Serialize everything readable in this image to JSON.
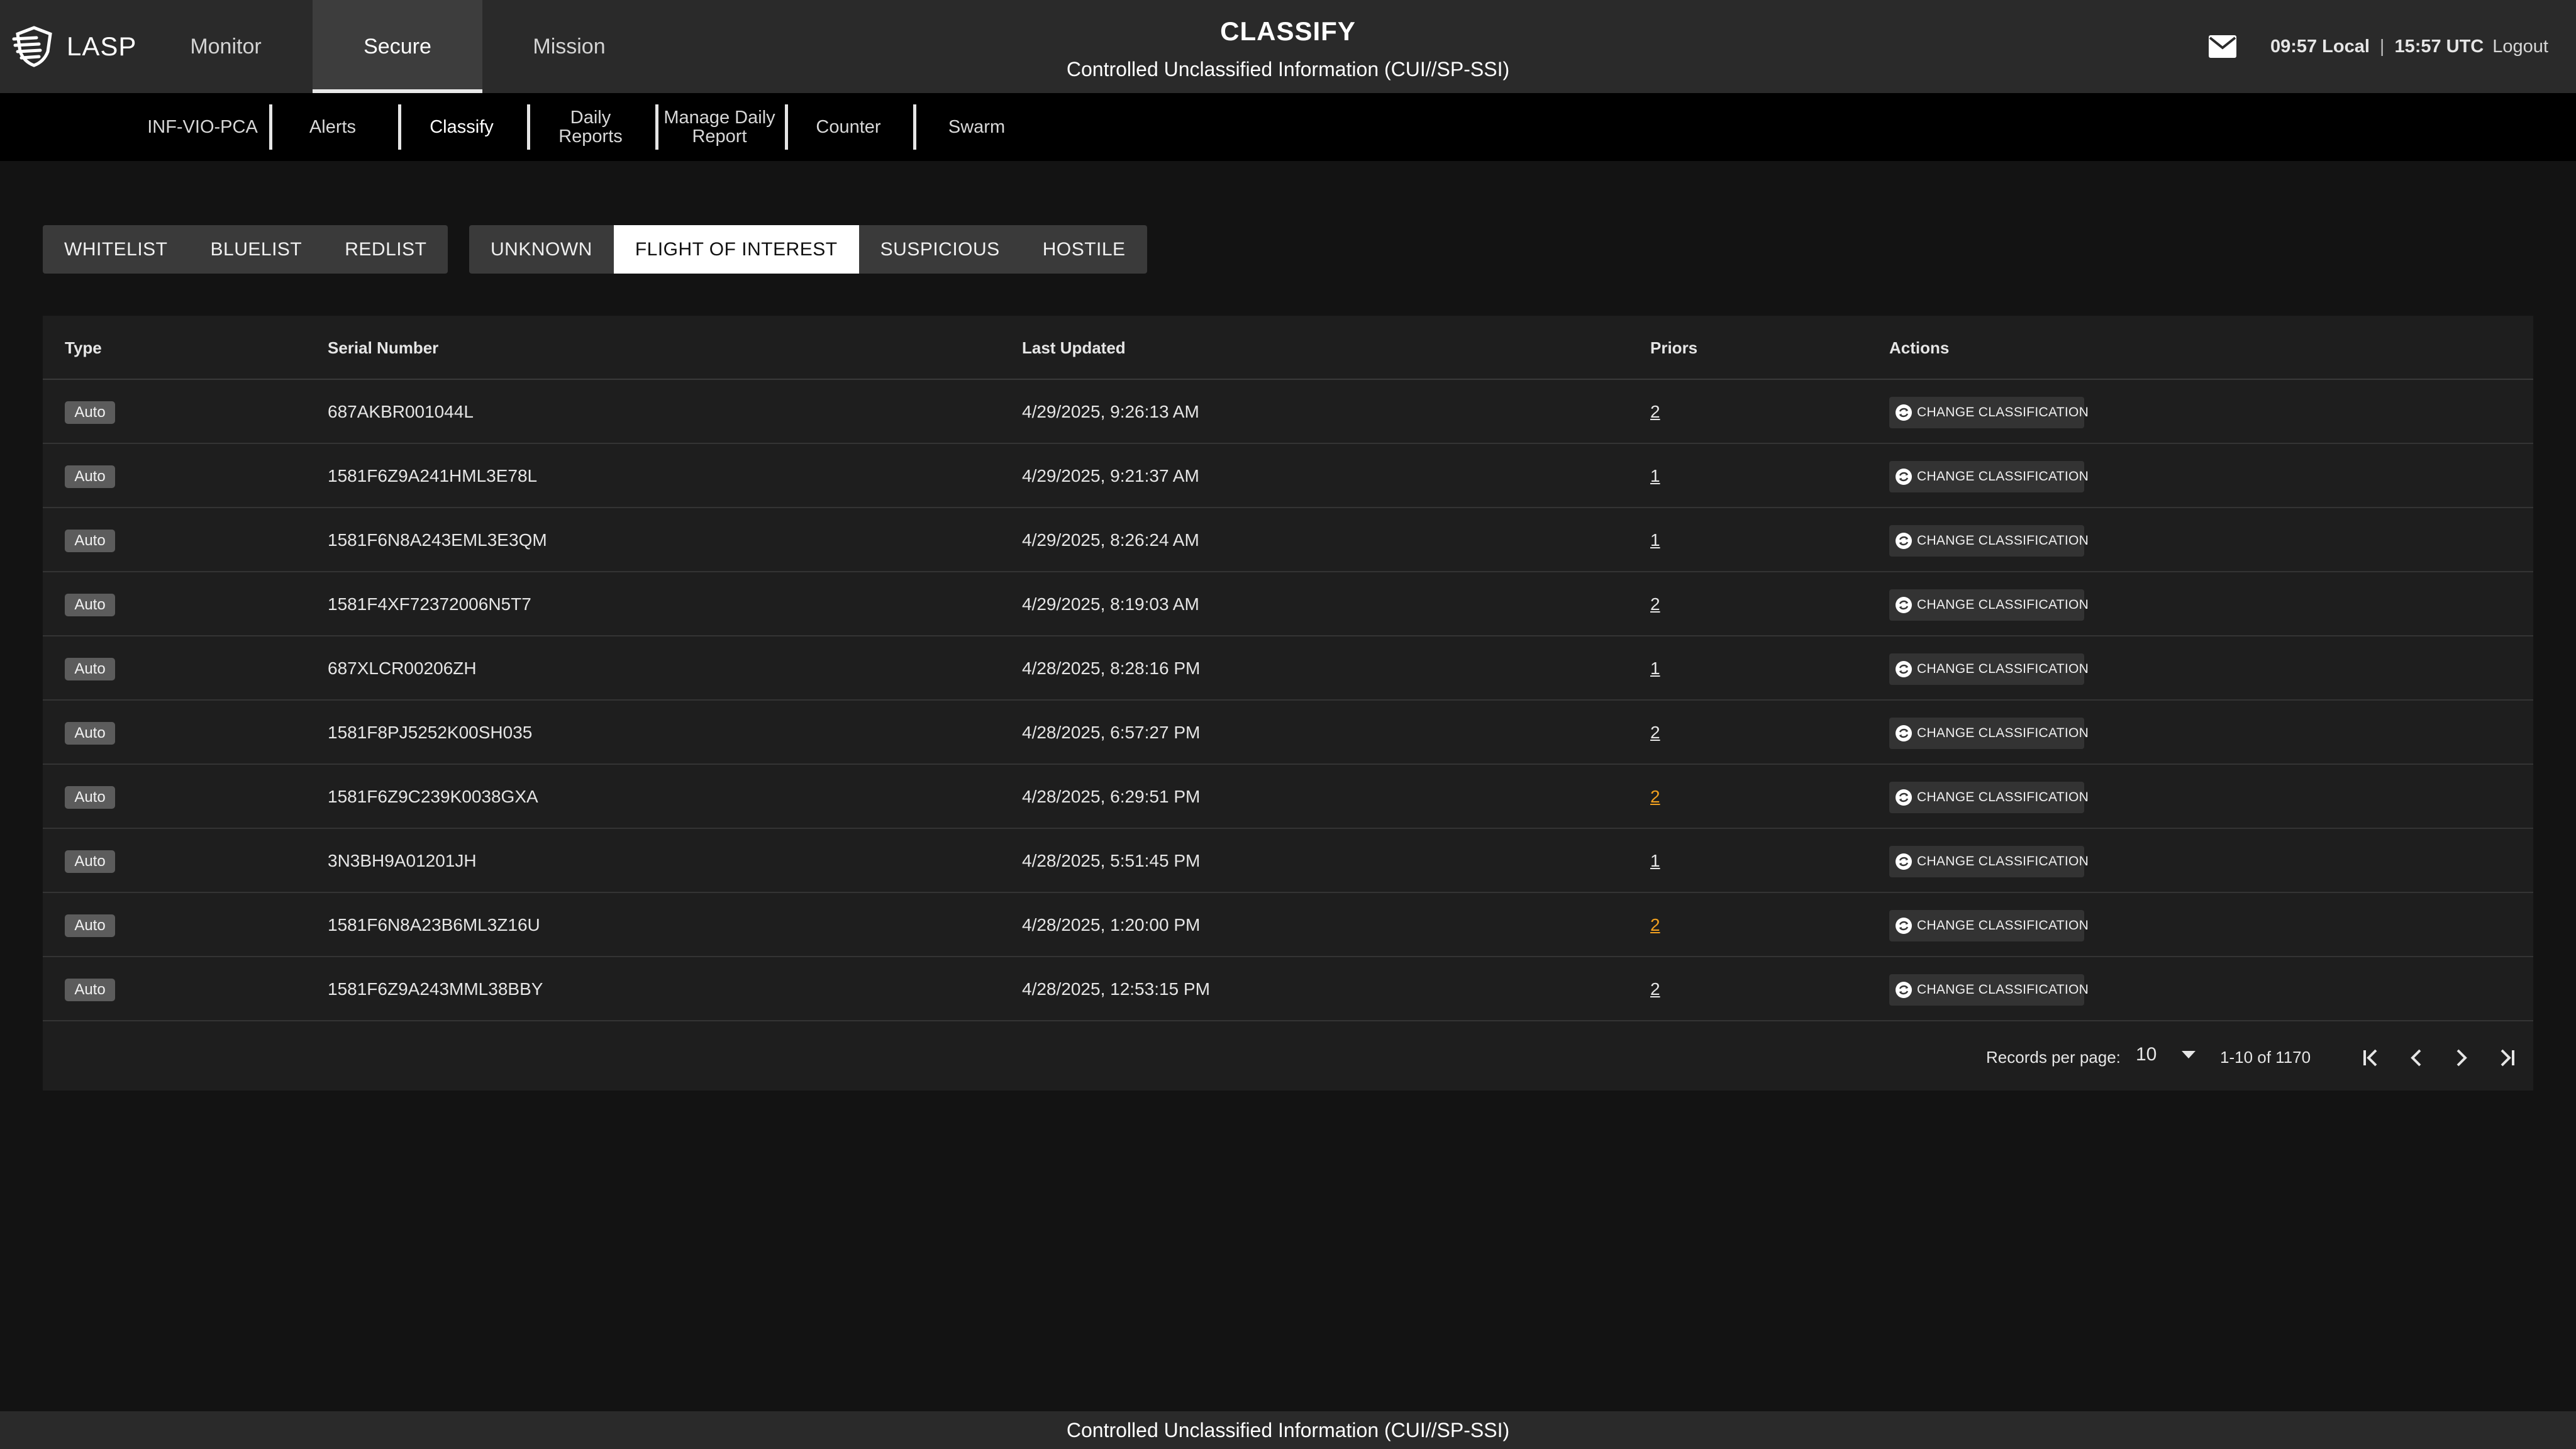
{
  "app": {
    "name": "LASP",
    "logo_icon": "shield-wing-icon"
  },
  "header": {
    "title": "CLASSIFY",
    "classification_banner": "Controlled Unclassified Information (CUI//SP-SSI)",
    "local_time": "09:57",
    "local_label": "Local",
    "utc_time": "15:57",
    "utc_label": "UTC",
    "logout_label": "Logout",
    "mail_icon": "mail-icon"
  },
  "top_tabs": [
    {
      "label": "Monitor",
      "active": false
    },
    {
      "label": "Secure",
      "active": true
    },
    {
      "label": "Mission",
      "active": false
    }
  ],
  "sub_tabs": [
    {
      "label": "INF-VIO-PCA",
      "active": false
    },
    {
      "label": "Alerts",
      "active": false
    },
    {
      "label": "Classify",
      "active": true
    },
    {
      "label": "Daily Reports",
      "active": false
    },
    {
      "label": "Manage Daily Report",
      "active": false
    },
    {
      "label": "Counter",
      "active": false
    },
    {
      "label": "Swarm",
      "active": false
    }
  ],
  "list_filters": [
    {
      "label": "WHITELIST",
      "active": false
    },
    {
      "label": "BLUELIST",
      "active": false
    },
    {
      "label": "REDLIST",
      "active": false
    }
  ],
  "category_filters": [
    {
      "label": "UNKNOWN",
      "active": false
    },
    {
      "label": "FLIGHT OF INTEREST",
      "active": true
    },
    {
      "label": "SUSPICIOUS",
      "active": false
    },
    {
      "label": "HOSTILE",
      "active": false
    }
  ],
  "table": {
    "columns": {
      "type": "Type",
      "serial": "Serial Number",
      "updated": "Last Updated",
      "priors": "Priors",
      "actions": "Actions"
    },
    "action_label": "CHANGE CLASSIFICATION",
    "action_icon": "sync-icon",
    "rows": [
      {
        "type": "Auto",
        "serial": "687AKBR001044L",
        "updated": "4/29/2025, 9:26:13 AM",
        "priors": "2",
        "priors_alert": false
      },
      {
        "type": "Auto",
        "serial": "1581F6Z9A241HML3E78L",
        "updated": "4/29/2025, 9:21:37 AM",
        "priors": "1",
        "priors_alert": false
      },
      {
        "type": "Auto",
        "serial": "1581F6N8A243EML3E3QM",
        "updated": "4/29/2025, 8:26:24 AM",
        "priors": "1",
        "priors_alert": false
      },
      {
        "type": "Auto",
        "serial": "1581F4XF72372006N5T7",
        "updated": "4/29/2025, 8:19:03 AM",
        "priors": "2",
        "priors_alert": false
      },
      {
        "type": "Auto",
        "serial": "687XLCR00206ZH",
        "updated": "4/28/2025, 8:28:16 PM",
        "priors": "1",
        "priors_alert": false
      },
      {
        "type": "Auto",
        "serial": "1581F8PJ5252K00SH035",
        "updated": "4/28/2025, 6:57:27 PM",
        "priors": "2",
        "priors_alert": false
      },
      {
        "type": "Auto",
        "serial": "1581F6Z9C239K0038GXA",
        "updated": "4/28/2025, 6:29:51 PM",
        "priors": "2",
        "priors_alert": true
      },
      {
        "type": "Auto",
        "serial": "3N3BH9A01201JH",
        "updated": "4/28/2025, 5:51:45 PM",
        "priors": "1",
        "priors_alert": false
      },
      {
        "type": "Auto",
        "serial": "1581F6N8A23B6ML3Z16U",
        "updated": "4/28/2025, 1:20:00 PM",
        "priors": "2",
        "priors_alert": true
      },
      {
        "type": "Auto",
        "serial": "1581F6Z9A243MML38BBY",
        "updated": "4/28/2025, 12:53:15 PM",
        "priors": "2",
        "priors_alert": false
      }
    ]
  },
  "pagination": {
    "records_per_page_label": "Records per page:",
    "records_per_page": "10",
    "range": "1-10 of 1170",
    "icons": [
      "first-page-icon",
      "prev-page-icon",
      "next-page-icon",
      "last-page-icon"
    ]
  },
  "footer": {
    "banner": "Controlled Unclassified Information (CUI//SP-SSI)"
  },
  "colors": {
    "alert_link": "#f0a020",
    "header_bg": "#2a2a2a",
    "page_bg": "#131313"
  }
}
